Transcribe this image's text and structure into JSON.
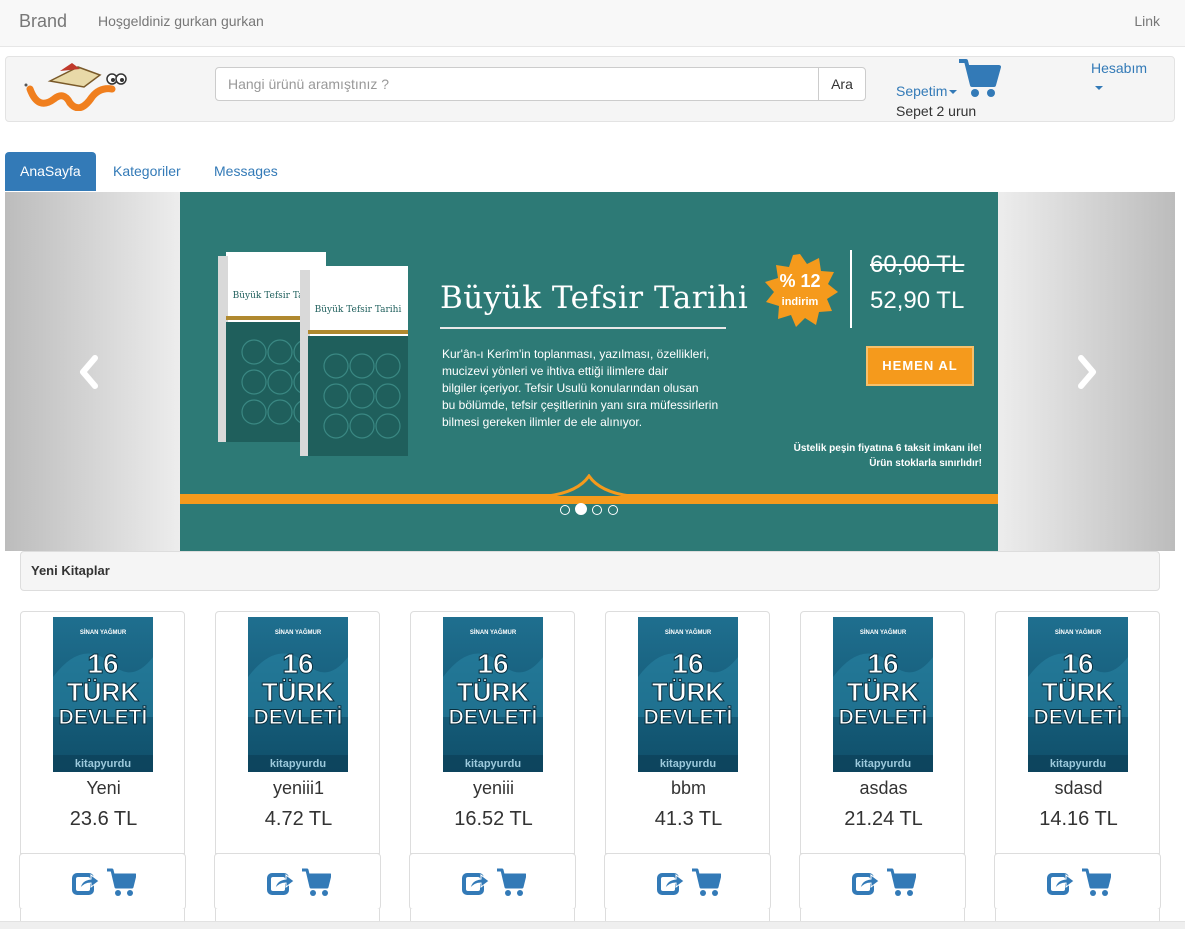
{
  "navbar": {
    "brand": "Brand",
    "welcome": "Hoşgeldiniz gurkan gurkan",
    "link": "Link"
  },
  "header": {
    "search_placeholder": "Hangi ürünü aramıştınız ?",
    "search_button": "Ara",
    "cart_label": "Sepetim",
    "cart_count_text": "Sepet 2 urun",
    "account_label": "Hesabım"
  },
  "tabs": [
    {
      "label": "AnaSayfa",
      "active": true
    },
    {
      "label": "Kategoriler",
      "active": false
    },
    {
      "label": "Messages",
      "active": false
    }
  ],
  "carousel": {
    "title": "Büyük Tefsir Tarihi",
    "description": "Kur'ân-ı Kerîm'in toplanması, yazılması, özellikleri,\nmucizevi yönleri ve ihtiva ettiği ilimlere dair\nbilgiler içeriyor. Tefsir Usulü konularından olusan\nbu bölümde, tefsir çeşitlerinin yanı sıra müfessirlerin\nbilmesi gereken ilimler de ele alınıyor.",
    "discount": "% 12",
    "discount_label": "indirim",
    "old_price": "60,00 TL",
    "new_price": "52,90 TL",
    "cta": "HEMEN AL",
    "note": "Üstelik peşin fiyatına 6 taksit imkanı ile!\nÜrün stoklarla sınırlıdır!",
    "book_title": "Büyük Tefsir Tarihi",
    "slide_count": 4,
    "active_slide": 1,
    "colors": {
      "slide_bg": "#2d7a76",
      "accent": "#f59a1c"
    }
  },
  "section": {
    "title": "Yeni Kitaplar"
  },
  "products": [
    {
      "name": "Yeni",
      "price": "23.6 TL"
    },
    {
      "name": "yeniii1",
      "price": "4.72 TL"
    },
    {
      "name": "yeniii",
      "price": "16.52 TL"
    },
    {
      "name": "bbm",
      "price": "41.3 TL"
    },
    {
      "name": "asdas",
      "price": "21.24 TL"
    },
    {
      "name": "sdasd",
      "price": "14.16 TL"
    }
  ],
  "cover": {
    "author": "SİNAN YAĞMUR",
    "line1": "16",
    "line2": "TÜRK",
    "line3": "DEVLETİ",
    "publisher": "kitapyurdu"
  },
  "icons": {
    "share": "share-square-icon",
    "cart": "shopping-cart-icon"
  },
  "colors": {
    "primary": "#337ab7",
    "navbar_bg": "#f8f8f8"
  }
}
